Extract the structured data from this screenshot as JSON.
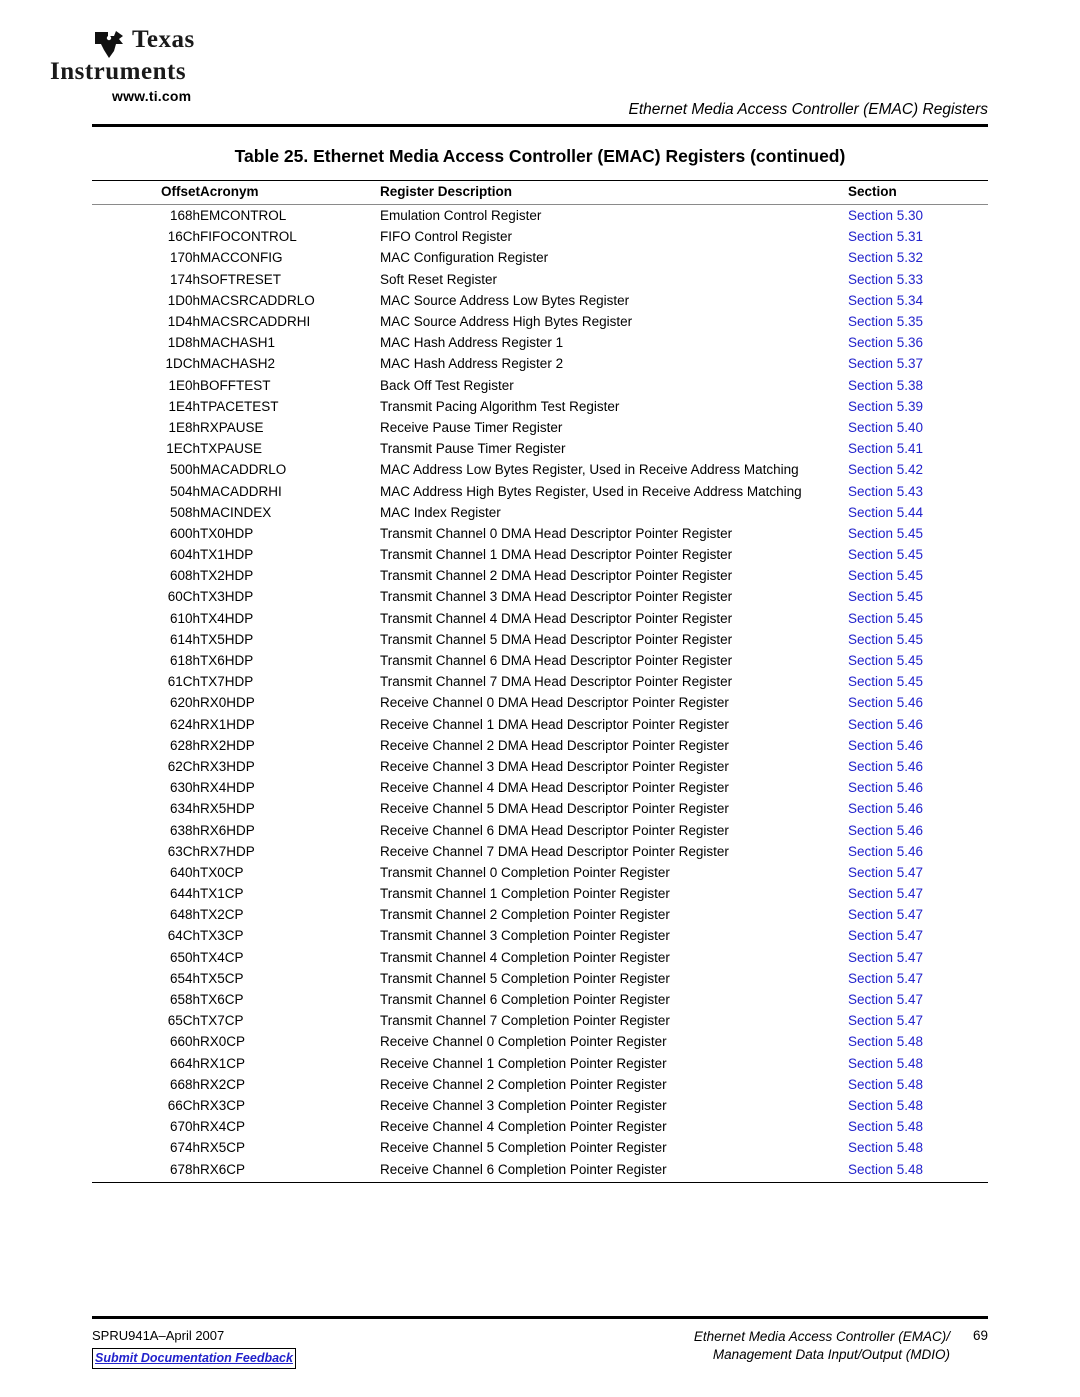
{
  "header": {
    "logo": {
      "line1": "Texas",
      "line2": "Instruments",
      "url": "www.ti.com",
      "icon": "ti-bug-logo"
    },
    "running_title": "Ethernet Media Access Controller (EMAC) Registers"
  },
  "table": {
    "title": "Table 25. Ethernet Media Access Controller (EMAC) Registers  (continued)",
    "columns": [
      "Offset",
      "Acronym",
      "Register Description",
      "Section"
    ],
    "link_color": "#2222cc",
    "rows": [
      [
        "168h",
        "EMCONTROL",
        "Emulation Control Register",
        "Section 5.30"
      ],
      [
        "16Ch",
        "FIFOCONTROL",
        "FIFO Control Register",
        "Section 5.31"
      ],
      [
        "170h",
        "MACCONFIG",
        "MAC Configuration Register",
        "Section 5.32"
      ],
      [
        "174h",
        "SOFTRESET",
        "Soft Reset Register",
        "Section 5.33"
      ],
      [
        "1D0h",
        "MACSRCADDRLO",
        "MAC Source Address Low Bytes Register",
        "Section 5.34"
      ],
      [
        "1D4h",
        "MACSRCADDRHI",
        "MAC Source Address High Bytes Register",
        "Section 5.35"
      ],
      [
        "1D8h",
        "MACHASH1",
        "MAC Hash Address Register 1",
        "Section 5.36"
      ],
      [
        "1DCh",
        "MACHASH2",
        "MAC Hash Address Register 2",
        "Section 5.37"
      ],
      [
        "1E0h",
        "BOFFTEST",
        "Back Off Test Register",
        "Section 5.38"
      ],
      [
        "1E4h",
        "TPACETEST",
        "Transmit Pacing Algorithm Test Register",
        "Section 5.39"
      ],
      [
        "1E8h",
        "RXPAUSE",
        "Receive Pause Timer Register",
        "Section 5.40"
      ],
      [
        "1ECh",
        "TXPAUSE",
        "Transmit Pause Timer Register",
        "Section 5.41"
      ],
      [
        "500h",
        "MACADDRLO",
        "MAC Address Low Bytes Register, Used in Receive Address Matching",
        "Section 5.42"
      ],
      [
        "504h",
        "MACADDRHI",
        "MAC Address High Bytes Register, Used in Receive Address Matching",
        "Section 5.43"
      ],
      [
        "508h",
        "MACINDEX",
        "MAC Index Register",
        "Section 5.44"
      ],
      [
        "600h",
        "TX0HDP",
        "Transmit Channel 0 DMA Head Descriptor Pointer Register",
        "Section 5.45"
      ],
      [
        "604h",
        "TX1HDP",
        "Transmit Channel 1 DMA Head Descriptor Pointer Register",
        "Section 5.45"
      ],
      [
        "608h",
        "TX2HDP",
        "Transmit Channel 2 DMA Head Descriptor Pointer Register",
        "Section 5.45"
      ],
      [
        "60Ch",
        "TX3HDP",
        "Transmit Channel 3 DMA Head Descriptor Pointer Register",
        "Section 5.45"
      ],
      [
        "610h",
        "TX4HDP",
        "Transmit Channel 4 DMA Head Descriptor Pointer Register",
        "Section 5.45"
      ],
      [
        "614h",
        "TX5HDP",
        "Transmit Channel 5 DMA Head Descriptor Pointer Register",
        "Section 5.45"
      ],
      [
        "618h",
        "TX6HDP",
        "Transmit Channel 6 DMA Head Descriptor Pointer Register",
        "Section 5.45"
      ],
      [
        "61Ch",
        "TX7HDP",
        "Transmit Channel 7 DMA Head Descriptor Pointer Register",
        "Section 5.45"
      ],
      [
        "620h",
        "RX0HDP",
        "Receive Channel 0 DMA Head Descriptor Pointer Register",
        "Section 5.46"
      ],
      [
        "624h",
        "RX1HDP",
        "Receive Channel 1 DMA Head Descriptor Pointer Register",
        "Section 5.46"
      ],
      [
        "628h",
        "RX2HDP",
        "Receive Channel 2 DMA Head Descriptor Pointer Register",
        "Section 5.46"
      ],
      [
        "62Ch",
        "RX3HDP",
        "Receive Channel 3 DMA Head Descriptor Pointer Register",
        "Section 5.46"
      ],
      [
        "630h",
        "RX4HDP",
        "Receive Channel 4 DMA Head Descriptor Pointer Register",
        "Section 5.46"
      ],
      [
        "634h",
        "RX5HDP",
        "Receive Channel 5 DMA Head Descriptor Pointer Register",
        "Section 5.46"
      ],
      [
        "638h",
        "RX6HDP",
        "Receive Channel 6 DMA Head Descriptor Pointer Register",
        "Section 5.46"
      ],
      [
        "63Ch",
        "RX7HDP",
        "Receive Channel 7 DMA Head Descriptor Pointer Register",
        "Section 5.46"
      ],
      [
        "640h",
        "TX0CP",
        "Transmit Channel 0 Completion Pointer Register",
        "Section 5.47"
      ],
      [
        "644h",
        "TX1CP",
        "Transmit Channel 1 Completion Pointer Register",
        "Section 5.47"
      ],
      [
        "648h",
        "TX2CP",
        "Transmit Channel 2 Completion Pointer Register",
        "Section 5.47"
      ],
      [
        "64Ch",
        "TX3CP",
        "Transmit Channel 3 Completion Pointer Register",
        "Section 5.47"
      ],
      [
        "650h",
        "TX4CP",
        "Transmit Channel 4 Completion Pointer Register",
        "Section 5.47"
      ],
      [
        "654h",
        "TX5CP",
        "Transmit Channel 5 Completion Pointer Register",
        "Section 5.47"
      ],
      [
        "658h",
        "TX6CP",
        "Transmit Channel 6 Completion Pointer Register",
        "Section 5.47"
      ],
      [
        "65Ch",
        "TX7CP",
        "Transmit Channel 7 Completion Pointer Register",
        "Section 5.47"
      ],
      [
        "660h",
        "RX0CP",
        "Receive Channel 0 Completion Pointer Register",
        "Section 5.48"
      ],
      [
        "664h",
        "RX1CP",
        "Receive Channel 1 Completion Pointer Register",
        "Section 5.48"
      ],
      [
        "668h",
        "RX2CP",
        "Receive Channel 2 Completion Pointer Register",
        "Section 5.48"
      ],
      [
        "66Ch",
        "RX3CP",
        "Receive Channel 3 Completion Pointer Register",
        "Section 5.48"
      ],
      [
        "670h",
        "RX4CP",
        "Receive Channel 4 Completion Pointer Register",
        "Section 5.48"
      ],
      [
        "674h",
        "RX5CP",
        "Receive Channel 5 Completion Pointer Register",
        "Section 5.48"
      ],
      [
        "678h",
        "RX6CP",
        "Receive Channel 6 Completion Pointer Register",
        "Section 5.48"
      ]
    ]
  },
  "footer": {
    "doc_id": "SPRU941A–April 2007",
    "feedback_link": "Submit Documentation Feedback",
    "title_line1": "Ethernet Media Access Controller (EMAC)/",
    "title_line2": "Management Data Input/Output (MDIO)",
    "page_number": "69"
  }
}
